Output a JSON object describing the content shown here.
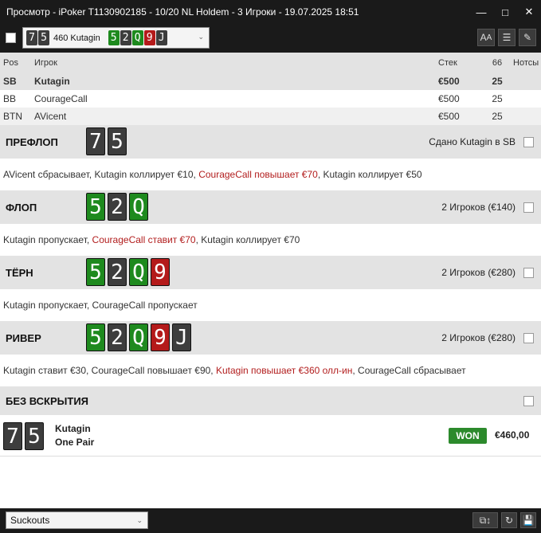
{
  "window": {
    "title": "Просмотр - iPoker T1130902185 - 10/20 NL Holdem - 3 Игроки - 19.07.2025 18:51",
    "minimize_icon": "minimize-icon",
    "maximize_icon": "maximize-icon",
    "close_icon": "close-icon"
  },
  "toolbar": {
    "hand_select": {
      "hole_cards": [
        "7",
        "5"
      ],
      "label": "460 Kutagin",
      "board": [
        {
          "rank": "5",
          "color": "green"
        },
        {
          "rank": "2",
          "color": "dark"
        },
        {
          "rank": "Q",
          "color": "green"
        },
        {
          "rank": "9",
          "color": "red"
        },
        {
          "rank": "J",
          "color": "dark"
        }
      ]
    },
    "icons": [
      "font-size-icon",
      "list-icon",
      "edit-icon"
    ]
  },
  "players": {
    "headers": {
      "pos": "Pos",
      "player": "Игрок",
      "stack": "Стек",
      "bb": "66",
      "notes": "Нотсы"
    },
    "rows": [
      {
        "pos": "SB",
        "name": "Kutagin",
        "stack": "€500",
        "bb": "25"
      },
      {
        "pos": "BB",
        "name": "CourageCall",
        "stack": "€500",
        "bb": "25"
      },
      {
        "pos": "BTN",
        "name": "AVicent",
        "stack": "€500",
        "bb": "25"
      }
    ]
  },
  "streets": [
    {
      "name": "ПРЕФЛОП",
      "cards": [
        {
          "rank": "7",
          "color": "dark"
        },
        {
          "rank": "5",
          "color": "dark"
        }
      ],
      "info": "Сдано Kutagin в SB",
      "actions": [
        {
          "text": "AVicent сбрасывает, Kutagin коллирует €10, ",
          "red": false
        },
        {
          "text": "CourageCall повышает €70",
          "red": true
        },
        {
          "text": ", Kutagin коллирует €50",
          "red": false
        }
      ]
    },
    {
      "name": "ФЛОП",
      "cards": [
        {
          "rank": "5",
          "color": "green"
        },
        {
          "rank": "2",
          "color": "dark"
        },
        {
          "rank": "Q",
          "color": "green"
        }
      ],
      "info": "2 Игроков (€140)",
      "actions": [
        {
          "text": "Kutagin пропускает, ",
          "red": false
        },
        {
          "text": "CourageCall ставит €70",
          "red": true
        },
        {
          "text": ", Kutagin коллирует €70",
          "red": false
        }
      ]
    },
    {
      "name": "ТЁРН",
      "cards": [
        {
          "rank": "5",
          "color": "green"
        },
        {
          "rank": "2",
          "color": "dark"
        },
        {
          "rank": "Q",
          "color": "green"
        },
        {
          "rank": "9",
          "color": "red"
        }
      ],
      "info": "2 Игроков (€280)",
      "actions": [
        {
          "text": "Kutagin пропускает, CourageCall пропускает",
          "red": false
        }
      ]
    },
    {
      "name": "РИВЕР",
      "cards": [
        {
          "rank": "5",
          "color": "green"
        },
        {
          "rank": "2",
          "color": "dark"
        },
        {
          "rank": "Q",
          "color": "green"
        },
        {
          "rank": "9",
          "color": "red"
        },
        {
          "rank": "J",
          "color": "dark"
        }
      ],
      "info": "2 Игроков (€280)",
      "actions": [
        {
          "text": "Kutagin ставит €30, CourageCall повышает €90, ",
          "red": false
        },
        {
          "text": "Kutagin повышает €360 олл-ин",
          "red": true
        },
        {
          "text": ", CourageCall сбрасывает",
          "red": false
        }
      ]
    }
  ],
  "showdown": {
    "title": "БЕЗ ВСКРЫТИЯ",
    "cards": [
      "7",
      "5"
    ],
    "player": "Kutagin",
    "hand": "One Pair",
    "badge": "WON",
    "amount": "€460,00"
  },
  "bottombar": {
    "filter_value": "Suckouts",
    "icons": [
      "copy-icon",
      "refresh-icon",
      "save-icon"
    ]
  },
  "colors": {
    "card_dark": "#3d3d3d",
    "card_green": "#1e8a1e",
    "card_red": "#b41a1a",
    "action_red": "#b21d1d",
    "won_badge": "#2c8a2c"
  }
}
